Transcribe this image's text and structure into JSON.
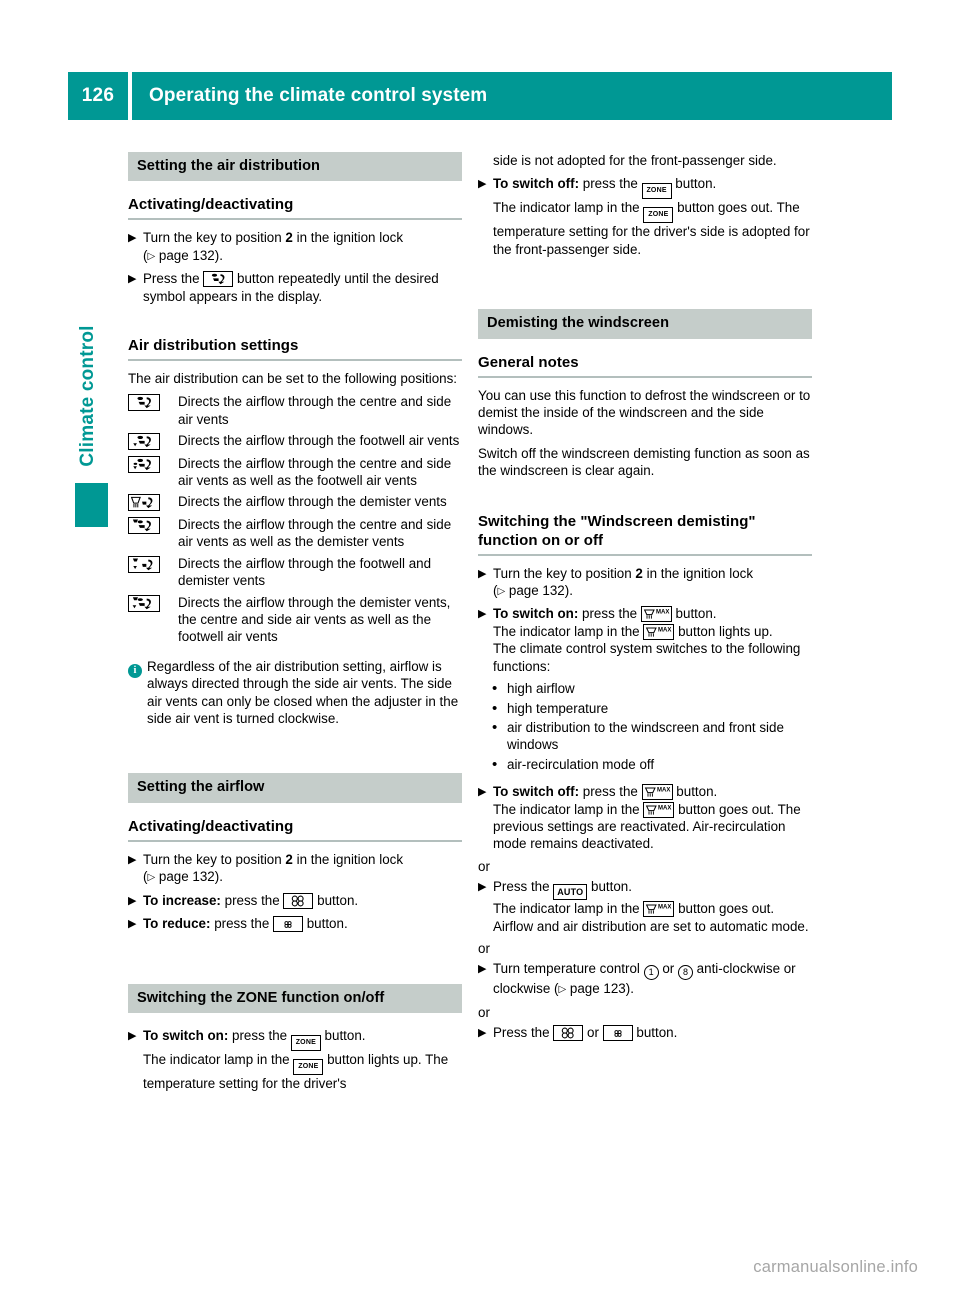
{
  "header": {
    "page_number": "126",
    "title": "Operating the climate control system"
  },
  "side_tab": {
    "label": "Climate control"
  },
  "footer": {
    "watermark": "carmanualsonline.info"
  },
  "markers": {
    "step": "▶",
    "rbullet": "•",
    "page_arrow": "▷",
    "info": "i"
  },
  "left_column": {
    "section_air_distribution": {
      "bar_title": "Setting the air distribution",
      "sub_title": "Activating/deactivating",
      "steps": [
        {
          "pre": "Turn the key to position ",
          "bold": "2",
          "post": " in the ignition lock",
          "ref_pre": "(",
          "ref_text": " page 132).",
          "icon": null
        },
        {
          "pre": "Press the ",
          "icon": "air-distribution-centre",
          "post": " button repeatedly until the desired symbol appears in the display."
        }
      ]
    },
    "section_settings": {
      "sub_title": "Air distribution settings",
      "intro": "The air distribution can be set to the following positions:",
      "rows": [
        {
          "icon": "centre-vents",
          "text": "Directs the airflow through the centre and side air vents"
        },
        {
          "icon": "footwell-vents",
          "text": "Directs the airflow through the footwell air vents"
        },
        {
          "icon": "centre-footwell-vents",
          "text": "Directs the airflow through the centre and side air vents as well as the footwell air vents"
        },
        {
          "icon": "demister-vents",
          "text": "Directs the airflow through the demister vents"
        },
        {
          "icon": "centre-demister-vents",
          "text": "Directs the airflow through the centre and side air vents as well as the demister vents"
        },
        {
          "icon": "footwell-demister-vents",
          "text": "Directs the airflow through the footwell and demister vents"
        },
        {
          "icon": "all-vents",
          "text": "Directs the airflow through the demister vents, the centre and side air vents as well as the footwell air vents"
        }
      ],
      "note": "Regardless of the air distribution setting, airflow is always directed through the side air vents. The side air vents can only be closed when the adjuster in the side air vent is turned clockwise."
    },
    "section_airflow": {
      "bar_title": "Setting the airflow",
      "sub_title": "Activating/deactivating",
      "steps": [
        {
          "pre": "Turn the key to position ",
          "bold": "2",
          "post": " in the ignition lock",
          "ref_text": " page 132)."
        },
        {
          "bold_lead": "To increase:",
          "mid": " press the ",
          "icon": "fan-increase",
          "post": " button."
        },
        {
          "bold_lead": "To reduce:",
          "mid": " press the ",
          "icon": "fan-reduce",
          "post": " button."
        }
      ]
    },
    "section_zone": {
      "bar_title": "Switching the ZONE function on/off",
      "steps": [
        {
          "bold_lead": "To switch on:",
          "mid": " press the ",
          "icon": "zone",
          "post": " button.",
          "line2_pre": "The indicator lamp in the ",
          "line2_icon": "zone",
          "line2_post": " button lights up. The temperature setting for the driver's"
        }
      ]
    }
  },
  "right_column": {
    "zone_continued": {
      "carryover": "side is not adopted for the front-passenger side.",
      "step": {
        "bold_lead": "To switch off:",
        "mid": " press the ",
        "icon": "zone",
        "post": " button.",
        "line2_pre": "The indicator lamp in the ",
        "line2_icon": "zone",
        "line2_post": " button goes out. The temperature setting for the driver's side is adopted for the front-passenger side."
      }
    },
    "section_demist": {
      "bar_title": "Demisting the windscreen",
      "sub_title": "General notes",
      "paragraphs": [
        "You can use this function to defrost the windscreen or to demist the inside of the windscreen and the side windows.",
        "Switch off the windscreen demisting function as soon as the windscreen is clear again."
      ]
    },
    "section_switching": {
      "sub_title": "Switching the \"Windscreen demisting\" function on or off",
      "step_key": {
        "pre": "Turn the key to position ",
        "bold": "2",
        "post": " in the ignition lock",
        "ref_text": " page 132)."
      },
      "step_on": {
        "bold_lead": "To switch on:",
        "mid": " press the ",
        "icon": "demist-max",
        "post": " button.",
        "line2_pre": "The indicator lamp in the ",
        "line2_icon": "demist-max",
        "line2_post": " button lights up.",
        "line3": "The climate control system switches to the following functions:"
      },
      "functions": [
        "high airflow",
        "high temperature",
        "air distribution to the windscreen and front side windows",
        "air-recirculation mode off"
      ],
      "step_off": {
        "bold_lead": "To switch off:",
        "mid": " press the ",
        "icon": "demist-max",
        "post": " button.",
        "line2_pre": "The indicator lamp in the ",
        "line2_icon": "demist-max",
        "line2_post": " button goes out. The previous settings are reactivated. Air-recirculation mode remains deactivated."
      },
      "or_label_1": "or",
      "step_auto": {
        "pre": "Press the ",
        "icon": "auto",
        "post": " button.",
        "line2_pre": "The indicator lamp in the ",
        "line2_icon": "demist-max",
        "line2_post": " button goes out. Airflow and air distribution are set to automatic mode."
      },
      "or_label_2": "or",
      "step_temp": {
        "pre": "Turn temperature control ",
        "circle_1": "1",
        "mid": " or ",
        "circle_2": "8",
        "post": " anti-clockwise or clockwise (",
        "ref_text": " page 123)."
      },
      "or_label_3": "or",
      "step_fan": {
        "pre": "Press the ",
        "icon_1": "fan-increase",
        "mid": " or ",
        "icon_2": "fan-reduce",
        "post": " button."
      }
    }
  },
  "colors": {
    "teal": "#009894",
    "bar_grey": "#c5cdca",
    "rule_grey": "#b3bfbd",
    "watermark_grey": "#a6a6a6"
  }
}
